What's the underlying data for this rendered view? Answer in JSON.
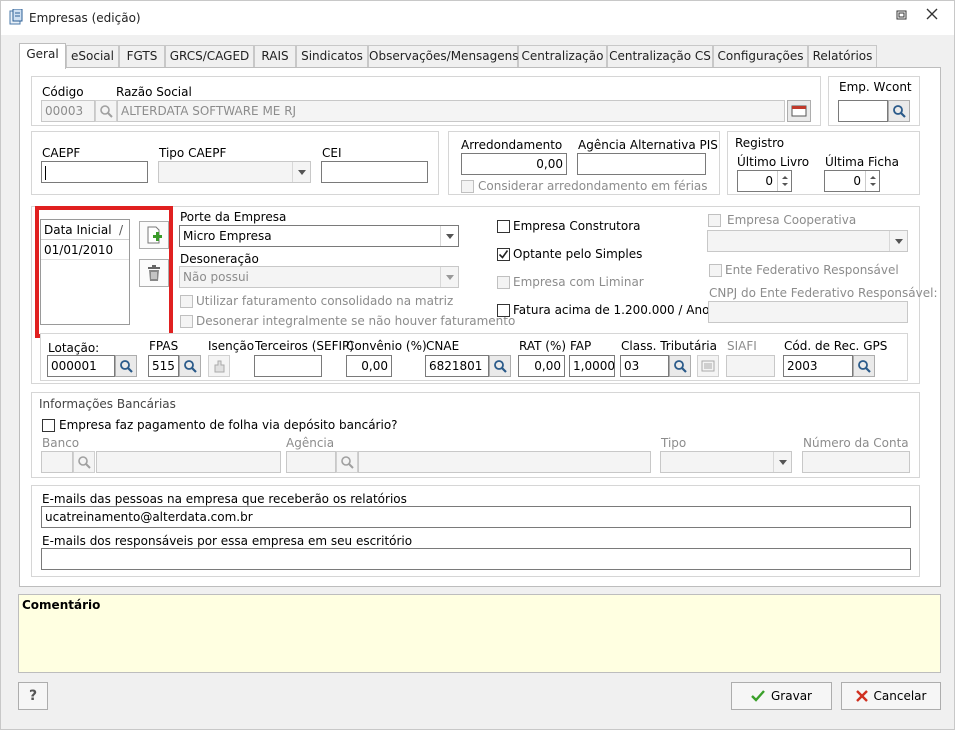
{
  "window": {
    "title": "Empresas (edição)"
  },
  "tabs": [
    "Geral",
    "eSocial",
    "FGTS",
    "GRCS/CAGED",
    "RAIS",
    "Sindicatos",
    "Observações/Mensagens",
    "Centralização",
    "Centralização CS",
    "Configurações",
    "Relatórios"
  ],
  "top": {
    "codigo_label": "Código",
    "codigo_value": "00003",
    "razao_label": "Razão Social",
    "razao_value": "ALTERDATA SOFTWARE ME RJ",
    "emp_wcont_label": "Emp. Wcont",
    "emp_wcont_value": ""
  },
  "caepf": {
    "caepf_label": "CAEPF",
    "caepf_value": "",
    "tipo_label": "Tipo CAEPF",
    "tipo_value": "",
    "cei_label": "CEI",
    "cei_value": ""
  },
  "arred": {
    "arred_label": "Arredondamento",
    "arred_value": "0,00",
    "agencia_label": "Agência Alternativa PIS",
    "agencia_value": "",
    "considerar_label": "Considerar arredondamento em férias"
  },
  "registro": {
    "title": "Registro",
    "ultimo_livro_label": "Último Livro",
    "ultimo_livro_value": "0",
    "ultima_ficha_label": "Última Ficha",
    "ultima_ficha_value": "0"
  },
  "datas": {
    "header": "Data Inicial",
    "sort_glyph": "/",
    "rows": [
      "01/01/2010"
    ]
  },
  "porte": {
    "porte_label": "Porte da Empresa",
    "porte_value": "Micro Empresa",
    "desoneracao_label": "Desoneração",
    "desoneracao_value": "Não possui",
    "utilizar_label": "Utilizar faturamento consolidado na matriz",
    "desonerar_label": "Desonerar integralmente se não houver faturamento"
  },
  "checks": {
    "construtora": "Empresa Construtora",
    "simples": "Optante pelo Simples",
    "liminar": "Empresa com Liminar",
    "fatura": "Fatura acima de 1.200.000 / Ano",
    "cooperativa": "Empresa Cooperativa",
    "ente_federativo": "Ente Federativo Responsável",
    "cnpj_ente_label": "CNPJ do Ente Federativo Responsável:",
    "cnpj_ente_value": ""
  },
  "lotacao": {
    "lotacao_label": "Lotação:",
    "lotacao_value": "000001",
    "fpas_label": "FPAS",
    "fpas_value": "515",
    "isencao_label": "Isenção",
    "terceiros_label": "Terceiros (SEFIP)",
    "terceiros_value": "",
    "convenio_label": "Convênio (%)",
    "convenio_value": "0,00",
    "cnae_label": "CNAE",
    "cnae_value": "6821801",
    "rat_label": "RAT (%)",
    "rat_value": "0,00",
    "fap_label": "FAP",
    "fap_value": "1,0000",
    "class_label": "Class. Tributária",
    "class_value": "03",
    "siafi_label": "SIAFI",
    "siafi_value": "",
    "gps_label": "Cód. de Rec. GPS",
    "gps_value": "2003"
  },
  "bancarias": {
    "title": "Informações Bancárias",
    "pagamento_label": "Empresa faz pagamento de folha via depósito bancário?",
    "banco_label": "Banco",
    "agencia_label": "Agência",
    "tipo_label": "Tipo",
    "conta_label": "Número da Conta"
  },
  "emails": {
    "pessoas_label": "E-mails das pessoas na empresa que receberão os relatórios",
    "pessoas_value": "ucatreinamento@alterdata.com.br",
    "responsaveis_label": "E-mails dos responsáveis por essa empresa em seu escritório",
    "responsaveis_value": ""
  },
  "comentario": {
    "label": "Comentário"
  },
  "footer": {
    "help_label": "?",
    "gravar_label": "Gravar",
    "cancelar_label": "Cancelar"
  },
  "colors": {
    "highlight": "#e02020",
    "comment_bg": "#ffffe1",
    "accent": "#2a7fd4"
  }
}
